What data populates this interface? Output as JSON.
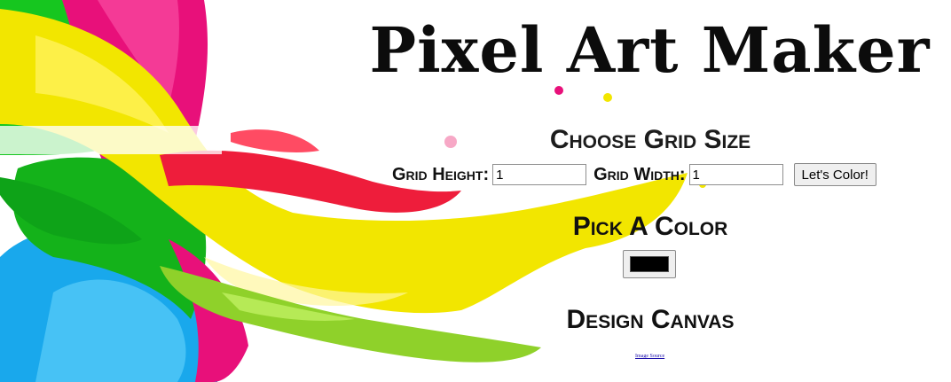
{
  "page": {
    "title": "Pixel Art Maker"
  },
  "grid_section": {
    "heading": "Choose Grid Size",
    "height_label": "Grid Height:",
    "height_value": "1",
    "width_label": "Grid Width:",
    "width_value": "1",
    "submit_label": "Let's Color!"
  },
  "color_section": {
    "heading": "Pick A Color",
    "selected_color": "#000000"
  },
  "canvas_section": {
    "heading": "Design Canvas"
  },
  "footer": {
    "image_source_link": "Image Source"
  },
  "background": {
    "image": "paint-splash-illustration",
    "colors": [
      "#f2e600",
      "#e8107a",
      "#16c61f",
      "#19a8ec",
      "#ee1d3b",
      "#8fd12a"
    ]
  }
}
